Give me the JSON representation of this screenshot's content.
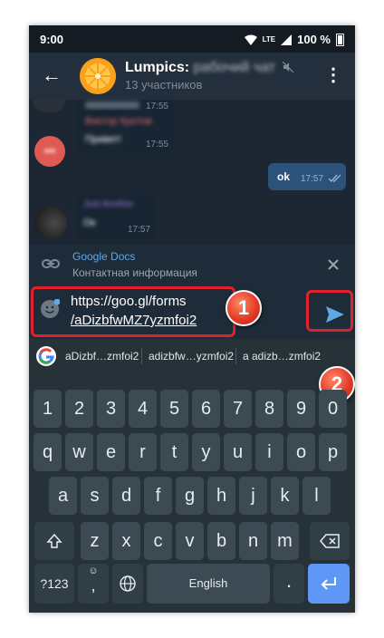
{
  "status_bar": {
    "time": "9:00",
    "network": "LTE",
    "battery": "100 %"
  },
  "header": {
    "back_icon": "arrow-left-icon",
    "title": "Lumpics:",
    "title_blurred": "рабочий чат",
    "subtitle": "13 участников",
    "menu_icon": "more-vert-icon"
  },
  "messages": [
    {
      "time": "17:55",
      "sender": "",
      "text": ""
    },
    {
      "time": "17:55",
      "sender": "Виктор Кротов",
      "text": "Привет!"
    },
    {
      "time": "17:57",
      "sender": "",
      "text": "ok",
      "outgoing": true
    },
    {
      "time": "17:57",
      "sender": "Just Another",
      "text": "Ок"
    }
  ],
  "link_preview": {
    "title": "Google Docs",
    "description": "Контактная информация",
    "link_icon": "link-icon",
    "close_icon": "close-icon"
  },
  "input": {
    "line1": "https://goo.gl/forms",
    "line2": "/aDizbfwMZ7yzmfoi2",
    "emoji_icon": "sticker-icon",
    "send_icon": "send-icon"
  },
  "annotations": {
    "badge_1": "1",
    "badge_2": "2"
  },
  "keyboard": {
    "suggestions": [
      "aDizbf…zmfoi2",
      "adizbfw…yzmfoi2",
      "a adizb…zmfoi2"
    ],
    "row_numbers": [
      "1",
      "2",
      "3",
      "4",
      "5",
      "6",
      "7",
      "8",
      "9",
      "0"
    ],
    "row_top": [
      "q",
      "w",
      "e",
      "r",
      "t",
      "y",
      "u",
      "i",
      "o",
      "p"
    ],
    "row_middle": [
      "a",
      "s",
      "d",
      "f",
      "g",
      "h",
      "j",
      "k",
      "l"
    ],
    "row_bottom": [
      "z",
      "x",
      "c",
      "v",
      "b",
      "n",
      "m"
    ],
    "symbols_key": "?123",
    "comma_key": ",",
    "space_key": "English",
    "period_key": ".",
    "shift_icon": "shift-icon",
    "backspace_icon": "backspace-icon",
    "globe_icon": "globe-icon",
    "enter_icon": "enter-icon",
    "emoji_small": "☺",
    "accent_color": "#5e97f6"
  }
}
